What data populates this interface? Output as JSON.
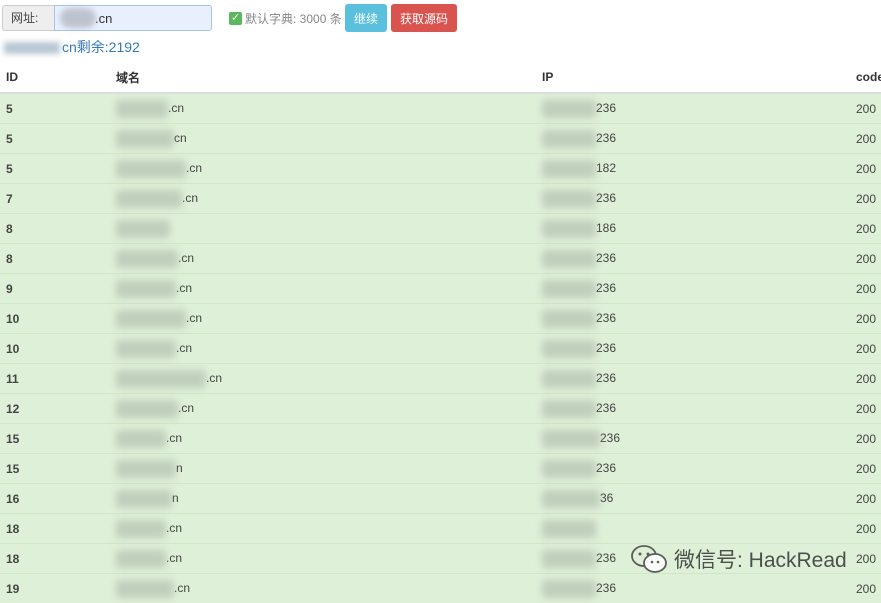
{
  "toolbar": {
    "url_label": "网址:",
    "url_value": ".cn",
    "dict_label": "默认字典: 3000 条",
    "continue_label": "继续",
    "source_label": "获取源码"
  },
  "status": {
    "remaining": "cn剩余:2192"
  },
  "table": {
    "headers": {
      "id": "ID",
      "domain": "域名",
      "ip": "IP",
      "code": "code"
    },
    "rows": [
      {
        "id": "5",
        "domain": ".cn",
        "ip": "236",
        "code": "200"
      },
      {
        "id": "5",
        "domain": "cn",
        "ip": "236",
        "code": "200"
      },
      {
        "id": "5",
        "domain": ".cn",
        "ip": "182",
        "code": "200"
      },
      {
        "id": "7",
        "domain": ".cn",
        "ip": "236",
        "code": "200"
      },
      {
        "id": "8",
        "domain": "",
        "ip": "186",
        "code": "200"
      },
      {
        "id": "8",
        "domain": ".cn",
        "ip": "236",
        "code": "200"
      },
      {
        "id": "9",
        "domain": ".cn",
        "ip": "236",
        "code": "200"
      },
      {
        "id": "10",
        "domain": ".cn",
        "ip": "236",
        "code": "200"
      },
      {
        "id": "10",
        "domain": ".cn",
        "ip": "236",
        "code": "200"
      },
      {
        "id": "11",
        "domain": ".cn",
        "ip": "236",
        "code": "200"
      },
      {
        "id": "12",
        "domain": ".cn",
        "ip": "236",
        "code": "200"
      },
      {
        "id": "15",
        "domain": ".cn",
        "ip": "236",
        "code": "200"
      },
      {
        "id": "15",
        "domain": "n",
        "ip": "236",
        "code": "200"
      },
      {
        "id": "16",
        "domain": "n",
        "ip": "36",
        "code": "200"
      },
      {
        "id": "18",
        "domain": ".cn",
        "ip": "",
        "code": "200"
      },
      {
        "id": "18",
        "domain": ".cn",
        "ip": "236",
        "code": "200"
      },
      {
        "id": "19",
        "domain": ".cn",
        "ip": "236",
        "code": "200"
      }
    ]
  },
  "watermark": {
    "text": "微信号: HackRead",
    "icon": "wechat-icon"
  },
  "colors": {
    "row_success": "#dff0d8",
    "btn_info": "#5bc0de",
    "btn_danger": "#d9534f",
    "link": "#337ab7"
  }
}
